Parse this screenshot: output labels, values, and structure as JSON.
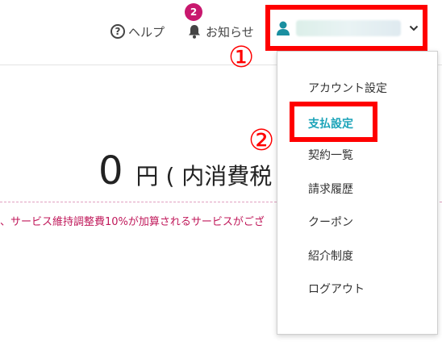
{
  "header": {
    "help_label": "ヘルプ",
    "notice_label": "お知らせ",
    "notice_badge": "2"
  },
  "annotations": {
    "marker_1": "①",
    "marker_2": "②"
  },
  "main": {
    "amount": "0",
    "unit_text": "円 ( 内消費税",
    "surcharge_text": "、サービス維持調整費10%が加算されるサービスがござ"
  },
  "menu": {
    "items": [
      {
        "label": "アカウント設定"
      },
      {
        "label": "支払設定"
      },
      {
        "label": "契約一覧"
      },
      {
        "label": "請求履歴"
      },
      {
        "label": "クーポン"
      },
      {
        "label": "紹介制度"
      },
      {
        "label": "ログアウト"
      }
    ]
  },
  "colors": {
    "highlight_red": "#ff0000",
    "badge": "#c8186e",
    "active_link": "#1aa3b8",
    "user_icon": "#1a8fa0",
    "notice_text": "#c0185a"
  },
  "icons": {
    "help": "question-circle-icon",
    "notice": "bell-icon",
    "user": "user-icon",
    "chevron": "chevron-down-icon"
  }
}
